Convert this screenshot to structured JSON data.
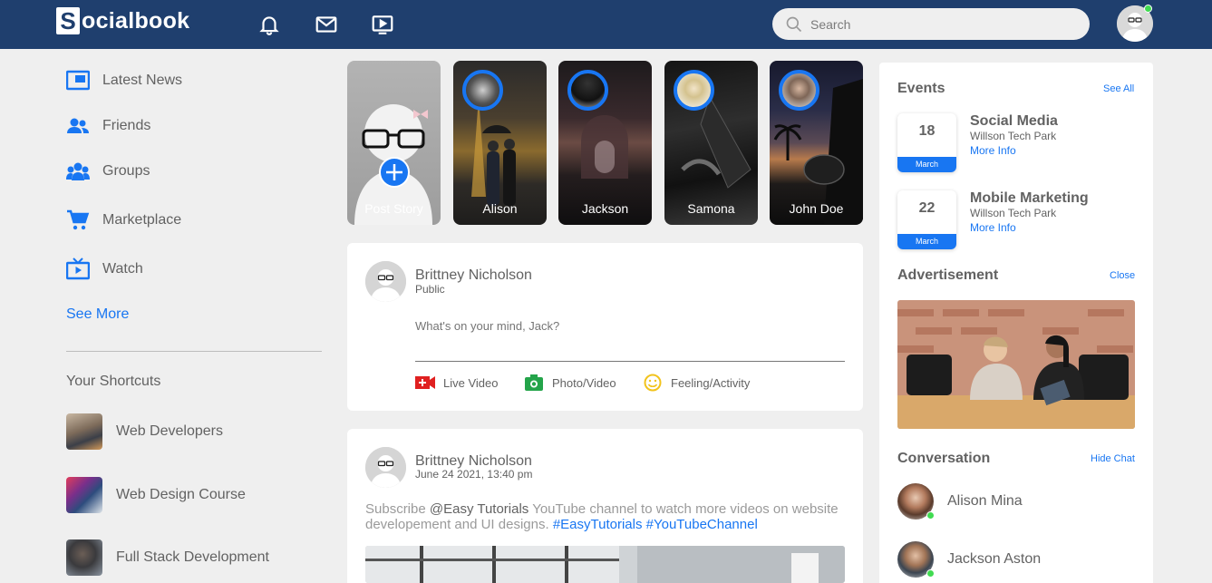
{
  "nav": {
    "logo_letter": "S",
    "logo_text": "ocialbook",
    "search_placeholder": "Search",
    "icons": [
      "bell-icon",
      "mail-icon",
      "video-icon"
    ]
  },
  "left": {
    "menu": [
      {
        "label": "Latest News",
        "icon": "news-icon"
      },
      {
        "label": "Friends",
        "icon": "friends-icon"
      },
      {
        "label": "Groups",
        "icon": "groups-icon"
      },
      {
        "label": "Marketplace",
        "icon": "cart-icon"
      },
      {
        "label": "Watch",
        "icon": "tv-icon"
      }
    ],
    "see_more": "See More",
    "shortcuts_title": "Your Shortcuts",
    "shortcuts": [
      "Web Developers",
      "Web Design Course",
      "Full Stack Development"
    ]
  },
  "stories": [
    "Post Story",
    "Alison",
    "Jackson",
    "Samona",
    "John Doe"
  ],
  "write_post": {
    "author": "Brittney Nicholson",
    "privacy": "Public",
    "placeholder": "What's on your mind, Jack?",
    "actions": [
      "Live Video",
      "Photo/Video",
      "Feeling/Activity"
    ]
  },
  "post": {
    "author": "Brittney Nicholson",
    "date": "June 24 2021, 13:40 pm",
    "text_1": "Subscribe ",
    "mention": "@Easy Tutorials",
    "text_2": " YouTube channel to watch more videos on website developement and UI designs. ",
    "tags": "#EasyTutorials #YouTubeChannel"
  },
  "right": {
    "events_title": "Events",
    "see_all": "See All",
    "events": [
      {
        "day": "18",
        "month": "March",
        "title": "Social Media",
        "place": "Willson Tech Park",
        "link": "More Info"
      },
      {
        "day": "22",
        "month": "March",
        "title": "Mobile Marketing",
        "place": "Willson Tech Park",
        "link": "More Info"
      }
    ],
    "ad_title": "Advertisement",
    "close": "Close",
    "conv_title": "Conversation",
    "hide_chat": "Hide Chat",
    "contacts": [
      "Alison Mina",
      "Jackson Aston"
    ]
  },
  "colors": {
    "navbar": "#1f3f6e",
    "accent": "#1876f2",
    "online": "#41db51"
  }
}
